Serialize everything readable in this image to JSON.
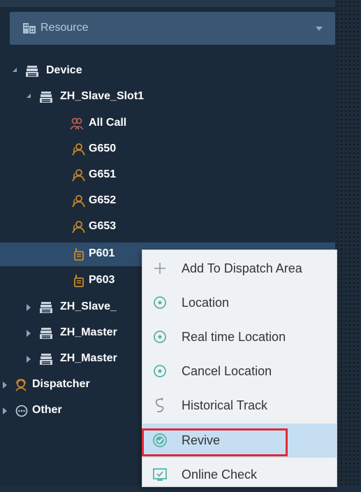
{
  "resource": {
    "label": "Resource"
  },
  "tree": {
    "device": "Device",
    "slot1": "ZH_Slave_Slot1",
    "groups": [
      "All Call",
      "G650",
      "G651",
      "G652",
      "G653"
    ],
    "devices": [
      "P601",
      "P603"
    ],
    "slave2": "ZH_Slave_",
    "master1": "ZH_Master",
    "master2": "ZH_Master",
    "dispatcher": "Dispatcher",
    "other": "Other"
  },
  "context_menu": {
    "items": [
      {
        "label": "Add To Dispatch Area",
        "icon": "plus-icon"
      },
      {
        "label": "Location",
        "icon": "location-icon"
      },
      {
        "label": "Real time Location",
        "icon": "location-icon"
      },
      {
        "label": "Cancel Location",
        "icon": "location-icon"
      },
      {
        "label": "Historical Track",
        "icon": "track-icon"
      },
      {
        "label": "Revive",
        "icon": "revive-icon"
      },
      {
        "label": "Online Check",
        "icon": "online-check-icon"
      }
    ],
    "highlighted": "Revive"
  },
  "colors": {
    "panel_bg": "#1b2a3b",
    "header_bg": "#3a5673",
    "selected_row": "#2e4c6b",
    "menu_bg": "#eff2f5",
    "menu_hover": "#c6def1",
    "highlight_border": "#e02a33",
    "icon_teal": "#57b3a8"
  }
}
